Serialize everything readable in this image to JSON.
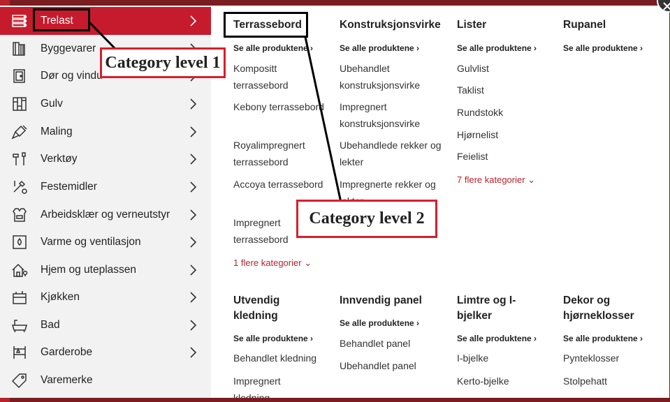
{
  "sidebar": {
    "items": [
      {
        "label": "Trelast",
        "icon": "lumber-icon",
        "active": true
      },
      {
        "label": "Byggevarer",
        "icon": "building-materials-icon"
      },
      {
        "label": "Dør og vindu",
        "icon": "door-icon"
      },
      {
        "label": "Gulv",
        "icon": "floor-icon"
      },
      {
        "label": "Maling",
        "icon": "paint-brush-icon"
      },
      {
        "label": "Verktøy",
        "icon": "tools-icon"
      },
      {
        "label": "Festemidler",
        "icon": "fasteners-icon"
      },
      {
        "label": "Arbeidsklær og verneutstyr",
        "icon": "workwear-icon"
      },
      {
        "label": "Varme og ventilasjon",
        "icon": "heating-icon"
      },
      {
        "label": "Hjem og uteplassen",
        "icon": "home-garden-icon"
      },
      {
        "label": "Kjøkken",
        "icon": "kitchen-icon"
      },
      {
        "label": "Bad",
        "icon": "bathtub-icon"
      },
      {
        "label": "Garderobe",
        "icon": "wardrobe-icon"
      },
      {
        "label": "Varemerke",
        "icon": "brand-tag-icon"
      }
    ]
  },
  "columns": {
    "terrassebord": {
      "title": "Terrassebord",
      "see_all": "Se alle produktene",
      "links": [
        "Kompositt terrassebord",
        "Kebony terrassebord",
        "Royalimpregnert terrassebord",
        "Accoya terrassebord",
        "Impregnert terrassebord"
      ],
      "more": "1 flere kategorier"
    },
    "konstruksjonsvirke": {
      "title": "Konstruksjonsvirke",
      "see_all": "Se alle produktene",
      "links": [
        "Ubehandlet konstruksjonsvirke",
        "Impregnert konstruksjonsvirke",
        "Ubehandlede rekker og lekter",
        "Impregnerte rekker og lekter"
      ]
    },
    "lister": {
      "title": "Lister",
      "see_all": "Se alle produktene",
      "links": [
        "Gulvlist",
        "Taklist",
        "Rundstokk",
        "Hjørnelist",
        "Feielist"
      ],
      "more": "7 flere kategorier"
    },
    "rupanel": {
      "title": "Rupanel",
      "see_all": "Se alle produktene"
    },
    "utvendig": {
      "title": "Utvendig kledning",
      "see_all": "Se alle produktene",
      "links": [
        "Behandlet kledning",
        "Impregnert kledning"
      ]
    },
    "innvendig": {
      "title": "Innvendig panel",
      "see_all": "Se alle produktene",
      "links": [
        "Behandlet panel",
        "Ubehandlet panel"
      ]
    },
    "limtre": {
      "title": "Limtre og I-bjelker",
      "see_all": "Se alle produktene",
      "links": [
        "I-bjelke",
        "Kerto-bjelke"
      ]
    },
    "dekor": {
      "title": "Dekor og hjørneklosser",
      "see_all": "Se alle produktene",
      "links": [
        "Pynteklosser",
        "Stolpehatt"
      ]
    }
  },
  "annotations": {
    "level1": "Category level 1",
    "level2": "Category level 2"
  },
  "colors": {
    "accent": "#c61b2c",
    "annotation_border": "#d6202b",
    "sidebar_bg": "#f2f2f2"
  }
}
